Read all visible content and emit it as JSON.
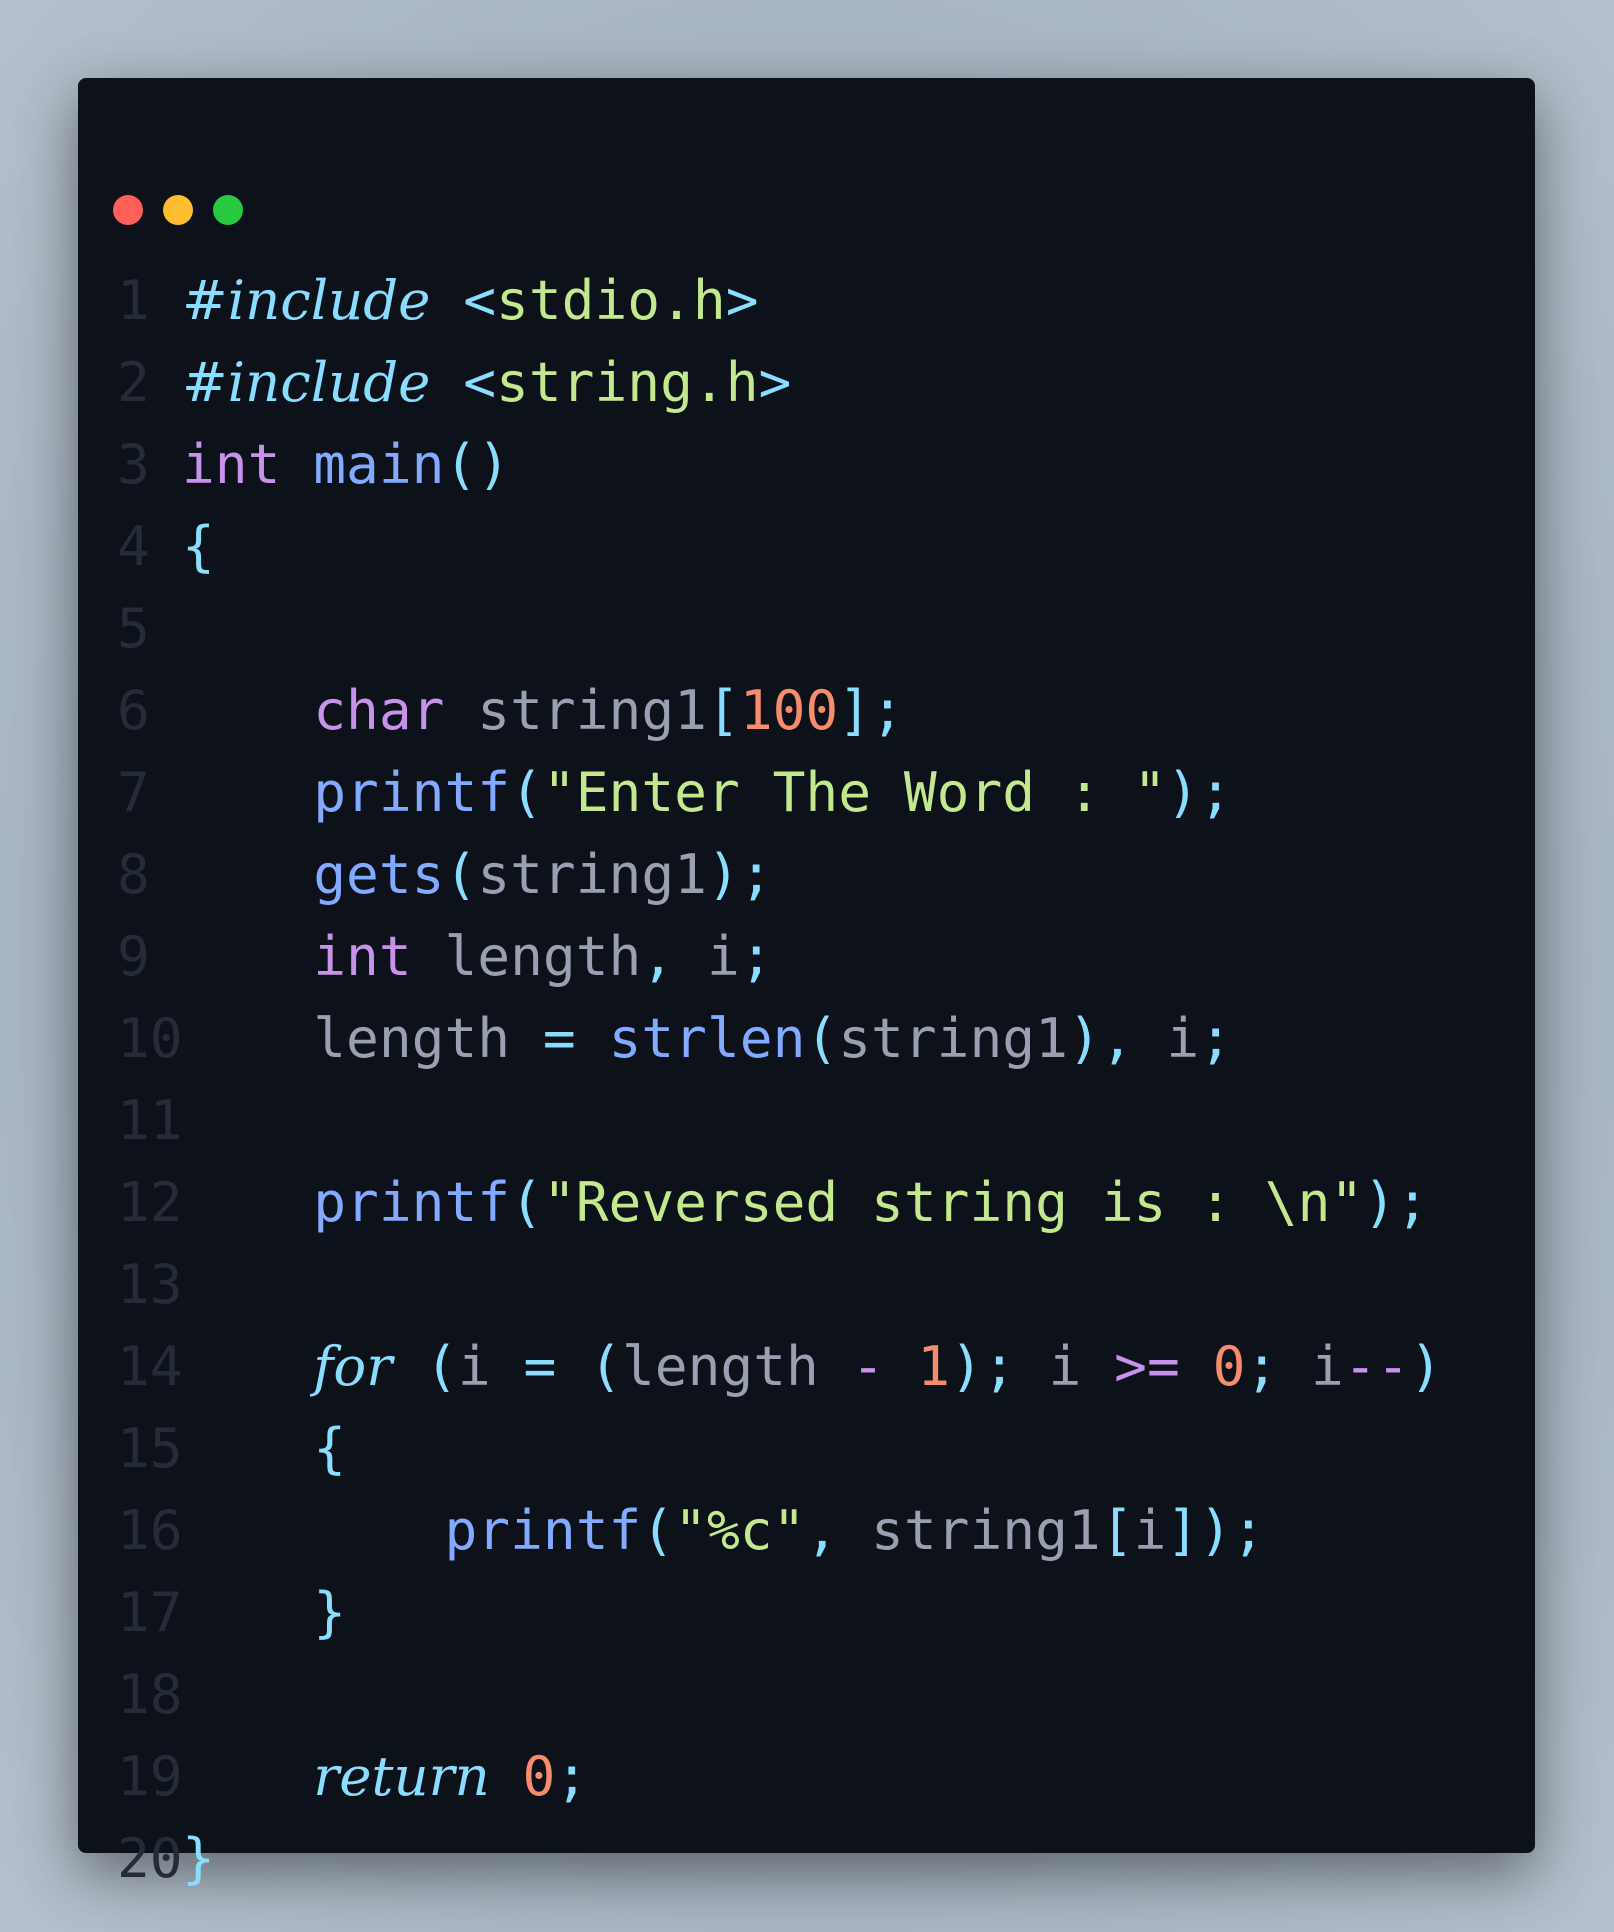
{
  "window_controls": [
    {
      "name": "close",
      "color": "#ff5f57"
    },
    {
      "name": "minimize",
      "color": "#febc2e"
    },
    {
      "name": "maximize",
      "color": "#28c840"
    }
  ],
  "code_lines": [
    [
      [
        "#include",
        "kw"
      ],
      [
        " ",
        "plain"
      ],
      [
        "<",
        "punc"
      ],
      [
        "stdio.h",
        "str"
      ],
      [
        ">",
        "punc"
      ]
    ],
    [
      [
        "#include",
        "kw"
      ],
      [
        " ",
        "plain"
      ],
      [
        "<",
        "punc"
      ],
      [
        "string.h",
        "str"
      ],
      [
        ">",
        "punc"
      ]
    ],
    [
      [
        "int",
        "type"
      ],
      [
        " ",
        "plain"
      ],
      [
        "main",
        "fn"
      ],
      [
        "()",
        "punc"
      ]
    ],
    [
      [
        "{",
        "punc"
      ]
    ],
    [],
    [
      [
        "    ",
        "plain"
      ],
      [
        "char",
        "type"
      ],
      [
        " string1",
        "var"
      ],
      [
        "[",
        "punc"
      ],
      [
        "100",
        "num"
      ],
      [
        "];",
        "punc"
      ]
    ],
    [
      [
        "    ",
        "plain"
      ],
      [
        "printf",
        "fn"
      ],
      [
        "(",
        "punc"
      ],
      [
        "\"Enter The Word : \"",
        "str"
      ],
      [
        ");",
        "punc"
      ]
    ],
    [
      [
        "    ",
        "plain"
      ],
      [
        "gets",
        "fn"
      ],
      [
        "(",
        "punc"
      ],
      [
        "string1",
        "var"
      ],
      [
        ");",
        "punc"
      ]
    ],
    [
      [
        "    ",
        "plain"
      ],
      [
        "int",
        "type"
      ],
      [
        " length",
        "var"
      ],
      [
        ",",
        "punc"
      ],
      [
        " i",
        "var"
      ],
      [
        ";",
        "punc"
      ]
    ],
    [
      [
        "    ",
        "plain"
      ],
      [
        "length",
        "var"
      ],
      [
        " = ",
        "punc"
      ],
      [
        "strlen",
        "fn"
      ],
      [
        "(",
        "punc"
      ],
      [
        "string1",
        "var"
      ],
      [
        "),",
        "punc"
      ],
      [
        " i",
        "var"
      ],
      [
        ";",
        "punc"
      ]
    ],
    [],
    [
      [
        "    ",
        "plain"
      ],
      [
        "printf",
        "fn"
      ],
      [
        "(",
        "punc"
      ],
      [
        "\"Reversed string is : \\n\"",
        "str"
      ],
      [
        ");",
        "punc"
      ]
    ],
    [],
    [
      [
        "    ",
        "plain"
      ],
      [
        "for",
        "kw"
      ],
      [
        " (",
        "punc"
      ],
      [
        "i",
        "var"
      ],
      [
        " = ",
        "punc"
      ],
      [
        "(",
        "punc"
      ],
      [
        "length",
        "var"
      ],
      [
        " - ",
        "op"
      ],
      [
        "1",
        "num"
      ],
      [
        ");",
        "punc"
      ],
      [
        " i",
        "var"
      ],
      [
        " >= ",
        "op"
      ],
      [
        "0",
        "num"
      ],
      [
        ";",
        "punc"
      ],
      [
        " i",
        "var"
      ],
      [
        "--",
        "op"
      ],
      [
        ")",
        "punc"
      ]
    ],
    [
      [
        "    ",
        "plain"
      ],
      [
        "{",
        "punc"
      ]
    ],
    [
      [
        "        ",
        "plain"
      ],
      [
        "printf",
        "fn"
      ],
      [
        "(",
        "punc"
      ],
      [
        "\"%c\"",
        "str"
      ],
      [
        ",",
        "punc"
      ],
      [
        " string1",
        "var"
      ],
      [
        "[",
        "punc"
      ],
      [
        "i",
        "var"
      ],
      [
        "]);",
        "punc"
      ]
    ],
    [
      [
        "    ",
        "plain"
      ],
      [
        "}",
        "punc"
      ]
    ],
    [],
    [
      [
        "    ",
        "plain"
      ],
      [
        "return",
        "kw"
      ],
      [
        " ",
        "plain"
      ],
      [
        "0",
        "num"
      ],
      [
        ";",
        "punc"
      ]
    ],
    [
      [
        "}",
        "punc"
      ]
    ]
  ]
}
